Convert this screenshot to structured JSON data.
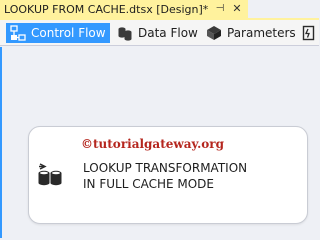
{
  "document_tab": {
    "title": "LOOKUP FROM CACHE.dtsx [Design]*",
    "pin_icon": "pin-icon",
    "close_icon": "close-icon"
  },
  "designer_tabs": [
    {
      "label": "Control Flow",
      "icon": "control-flow-icon",
      "active": true
    },
    {
      "label": "Data Flow",
      "icon": "data-flow-icon",
      "active": false
    },
    {
      "label": "Parameters",
      "icon": "parameters-icon",
      "active": false
    },
    {
      "label": "",
      "icon": "event-handlers-icon",
      "active": false
    }
  ],
  "canvas": {
    "task": {
      "watermark": "©tutorialgateway.org",
      "title_line1": "LOOKUP TRANSFORMATION",
      "title_line2": "IN FULL CACHE MODE",
      "icon": "data-flow-task-icon"
    }
  },
  "colors": {
    "active_tab": "#3399ff",
    "document_tab": "#fff29d",
    "watermark": "#b5261e",
    "canvas": "#eef0f5"
  }
}
